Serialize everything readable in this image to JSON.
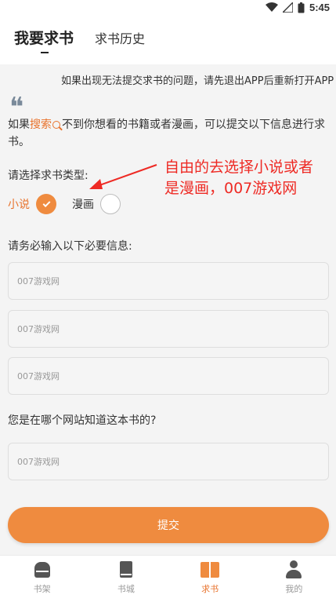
{
  "status_bar": {
    "time": "5:45",
    "icons": [
      "wifi-icon",
      "signal-icon",
      "battery-icon"
    ]
  },
  "header": {
    "tab_request": "我要求书",
    "tab_history": "求书历史"
  },
  "notice": {
    "text": "如果出现无法提交求书的问题，请先退出APP后重新打开APP"
  },
  "intro": {
    "prefix": "如果",
    "search_link": "搜索",
    "suffix": "不到你想看的书籍或者漫画，可以提交以下信息进行求书。"
  },
  "form": {
    "type_label": "请选择求书类型:",
    "options": [
      {
        "label": "小说",
        "selected": true
      },
      {
        "label": "漫画",
        "selected": false
      }
    ],
    "required_label": "请务必输入以下必要信息:",
    "inputs": [
      {
        "placeholder": "007游戏网",
        "value": ""
      },
      {
        "placeholder": "007游戏网",
        "value": ""
      },
      {
        "placeholder": "007游戏网",
        "value": ""
      }
    ],
    "source_label": "您是在哪个网站知道这本书的?",
    "source_input": {
      "placeholder": "007游戏网",
      "value": ""
    },
    "submit_label": "提交"
  },
  "annotation": {
    "line1": "自由的去选择小说或者",
    "line2": "是漫画，007游戏网",
    "color": "#ee2a24"
  },
  "bottom_nav": [
    {
      "label": "书架",
      "icon": "bookshelf-icon",
      "active": false
    },
    {
      "label": "书城",
      "icon": "bookstore-icon",
      "active": false
    },
    {
      "label": "求书",
      "icon": "request-book-icon",
      "active": true
    },
    {
      "label": "我的",
      "icon": "profile-icon",
      "active": false
    }
  ],
  "colors": {
    "accent": "#ef8b3f",
    "link": "#e8732d",
    "annotation": "#ee2a24"
  }
}
